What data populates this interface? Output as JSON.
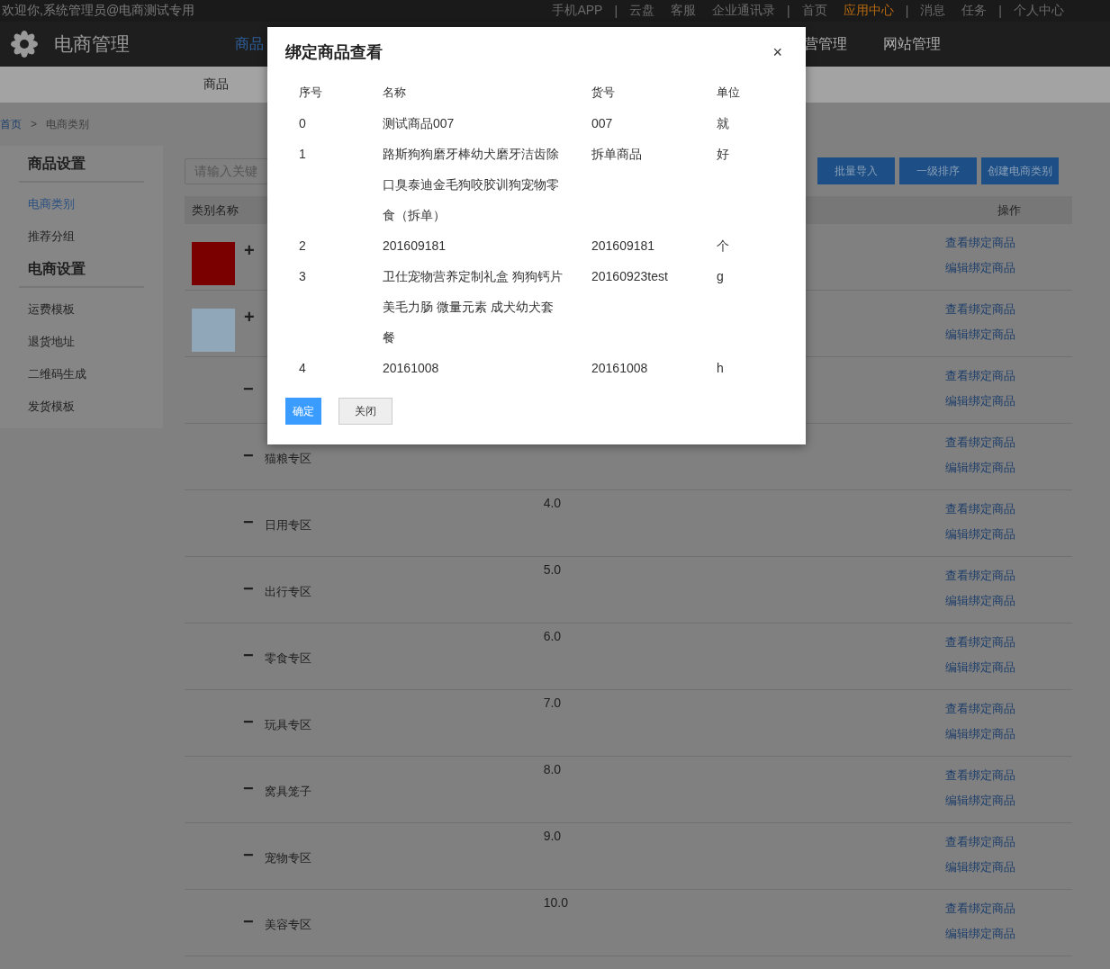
{
  "top_bar": {
    "welcome": "欢迎你,系统管理员@电商测试专用",
    "links": [
      {
        "kind": "link",
        "label": "手机APP",
        "selected": false
      },
      {
        "kind": "separator",
        "label": "|"
      },
      {
        "kind": "link",
        "label": "云盘",
        "selected": false
      },
      {
        "kind": "link",
        "label": "客服",
        "selected": false
      },
      {
        "kind": "link",
        "label": "企业通讯录",
        "selected": false
      },
      {
        "kind": "separator",
        "label": "|"
      },
      {
        "kind": "link",
        "label": "首页",
        "selected": false
      },
      {
        "kind": "link",
        "label": "应用中心",
        "selected": true
      },
      {
        "kind": "separator",
        "label": "|"
      },
      {
        "kind": "link",
        "label": "消息",
        "selected": false
      },
      {
        "kind": "link",
        "label": "任务",
        "selected": false
      },
      {
        "kind": "separator",
        "label": "|"
      },
      {
        "kind": "link",
        "label": "个人中心",
        "selected": false
      }
    ]
  },
  "header": {
    "logo": "电商管理",
    "nav": [
      {
        "label": "商品",
        "selected": true
      },
      {
        "label": "营管理",
        "selected": false
      },
      {
        "label": "网站管理",
        "selected": false
      }
    ]
  },
  "sub_nav": [
    "商品"
  ],
  "breadcrumb": [
    "首页",
    ">",
    "电商类别"
  ],
  "sidebar": {
    "groups": [
      {
        "title": "商品设置",
        "items": [
          {
            "label": "电商类别",
            "selected": true
          },
          {
            "label": "推荐分组",
            "selected": false
          }
        ]
      },
      {
        "title": "电商设置",
        "items": [
          {
            "label": "运费模板",
            "selected": false
          },
          {
            "label": "退货地址",
            "selected": false
          },
          {
            "label": "二维码生成",
            "selected": false
          },
          {
            "label": "发货模板",
            "selected": false
          }
        ]
      }
    ]
  },
  "search": {
    "placeholder": "请输入关键"
  },
  "buttons": [
    "批量导入",
    "一级排序",
    "创建电商类别"
  ],
  "table": {
    "columns": [
      "类别名称",
      "操作"
    ],
    "rows": [
      {
        "kind": "image",
        "color": "#7a0000",
        "toggle": "+",
        "actions": [
          "查看绑定商品",
          "编辑绑定商品"
        ]
      },
      {
        "kind": "image",
        "color": "#8fa7b8",
        "toggle": "+",
        "actions": [
          "查看绑定商品",
          "编辑绑定商品"
        ]
      },
      {
        "kind": "plain",
        "toggle": "−",
        "actions": [
          "查看绑定商品",
          "编辑绑定商品"
        ]
      },
      {
        "kind": "plain",
        "toggle": "−",
        "name": "猫粮专区",
        "actions": [
          "查看绑定商品",
          "编辑绑定商品"
        ]
      },
      {
        "kind": "plain",
        "toggle": "−",
        "name": "日用专区",
        "sort": "4.0",
        "actions": [
          "查看绑定商品",
          "编辑绑定商品"
        ]
      },
      {
        "kind": "plain",
        "toggle": "−",
        "name": "出行专区",
        "sort": "5.0",
        "actions": [
          "查看绑定商品",
          "编辑绑定商品"
        ]
      },
      {
        "kind": "plain",
        "toggle": "−",
        "name": "零食专区",
        "sort": "6.0",
        "actions": [
          "查看绑定商品",
          "编辑绑定商品"
        ]
      },
      {
        "kind": "plain",
        "toggle": "−",
        "name": "玩具专区",
        "sort": "7.0",
        "actions": [
          "查看绑定商品",
          "编辑绑定商品"
        ]
      },
      {
        "kind": "plain",
        "toggle": "−",
        "name": "窝具笼子",
        "sort": "8.0",
        "actions": [
          "查看绑定商品",
          "编辑绑定商品"
        ]
      },
      {
        "kind": "plain",
        "toggle": "−",
        "name": "宠物专区",
        "sort": "9.0",
        "actions": [
          "查看绑定商品",
          "编辑绑定商品"
        ]
      },
      {
        "kind": "plain",
        "toggle": "−",
        "name": "美容专区",
        "sort": "10.0",
        "actions": [
          "查看绑定商品",
          "编辑绑定商品"
        ]
      }
    ]
  },
  "dialog": {
    "title": "绑定商品查看",
    "close": "×",
    "columns": [
      "序号",
      "名称",
      "货号",
      "单位"
    ],
    "rows": [
      [
        "0",
        "测试商品007",
        "007",
        "就"
      ],
      [
        "1",
        "路斯狗狗磨牙棒幼犬磨牙洁齿除口臭泰迪金毛狗咬胶训狗宠物零食（拆单）",
        "拆单商品",
        "好"
      ],
      [
        "2",
        "201609181",
        "201609181",
        "个"
      ],
      [
        "3",
        "卫仕宠物营养定制礼盒 狗狗钙片美毛力肠 微量元素 成犬幼犬套餐",
        "20160923test",
        "g"
      ],
      [
        "4",
        "20161008",
        "20161008",
        "h"
      ]
    ],
    "buttons": [
      {
        "label": "确定",
        "kind": "primary"
      },
      {
        "label": "关闭",
        "kind": "default"
      }
    ]
  }
}
